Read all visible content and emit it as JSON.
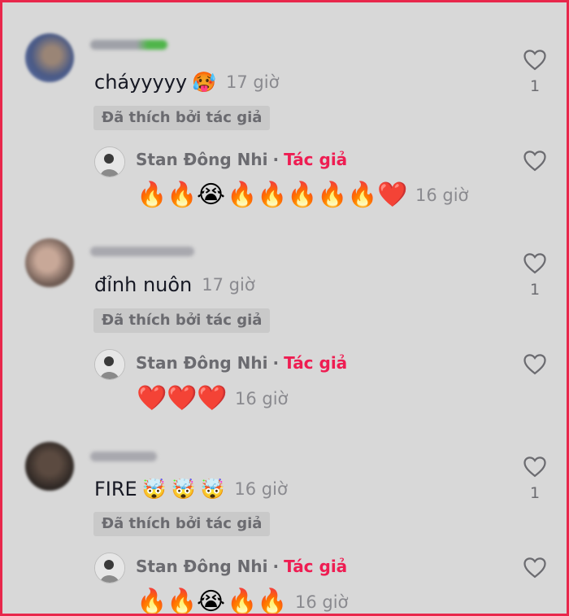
{
  "labels": {
    "liked_by_author": "Đã thích bởi tác giả",
    "author_tag": "Tác giả",
    "dot": "·"
  },
  "reply_author_name": "Stan Đông Nhi",
  "comments": [
    {
      "text": "cháyyyyy",
      "emoji": "🥵",
      "time": "17 giờ",
      "like_count": "1",
      "reply": {
        "emojis": [
          "🔥",
          "🔥",
          "😭",
          "🔥",
          "🔥",
          "🔥",
          "🔥",
          "🔥",
          "❤️"
        ],
        "time": "16 giờ"
      }
    },
    {
      "text": "đỉnh nuôn",
      "time": "17 giờ",
      "like_count": "1",
      "reply": {
        "emojis": [
          "❤️",
          "❤️",
          "❤️"
        ],
        "time": "16 giờ"
      }
    },
    {
      "text": "FIRE",
      "emoji_group": [
        "🤯",
        "🤯",
        "🤯"
      ],
      "time": "16 giờ",
      "like_count": "1",
      "reply": {
        "emojis": [
          "🔥",
          "🔥",
          "😭",
          "🔥",
          "🔥"
        ],
        "time": "16 giờ"
      }
    }
  ]
}
